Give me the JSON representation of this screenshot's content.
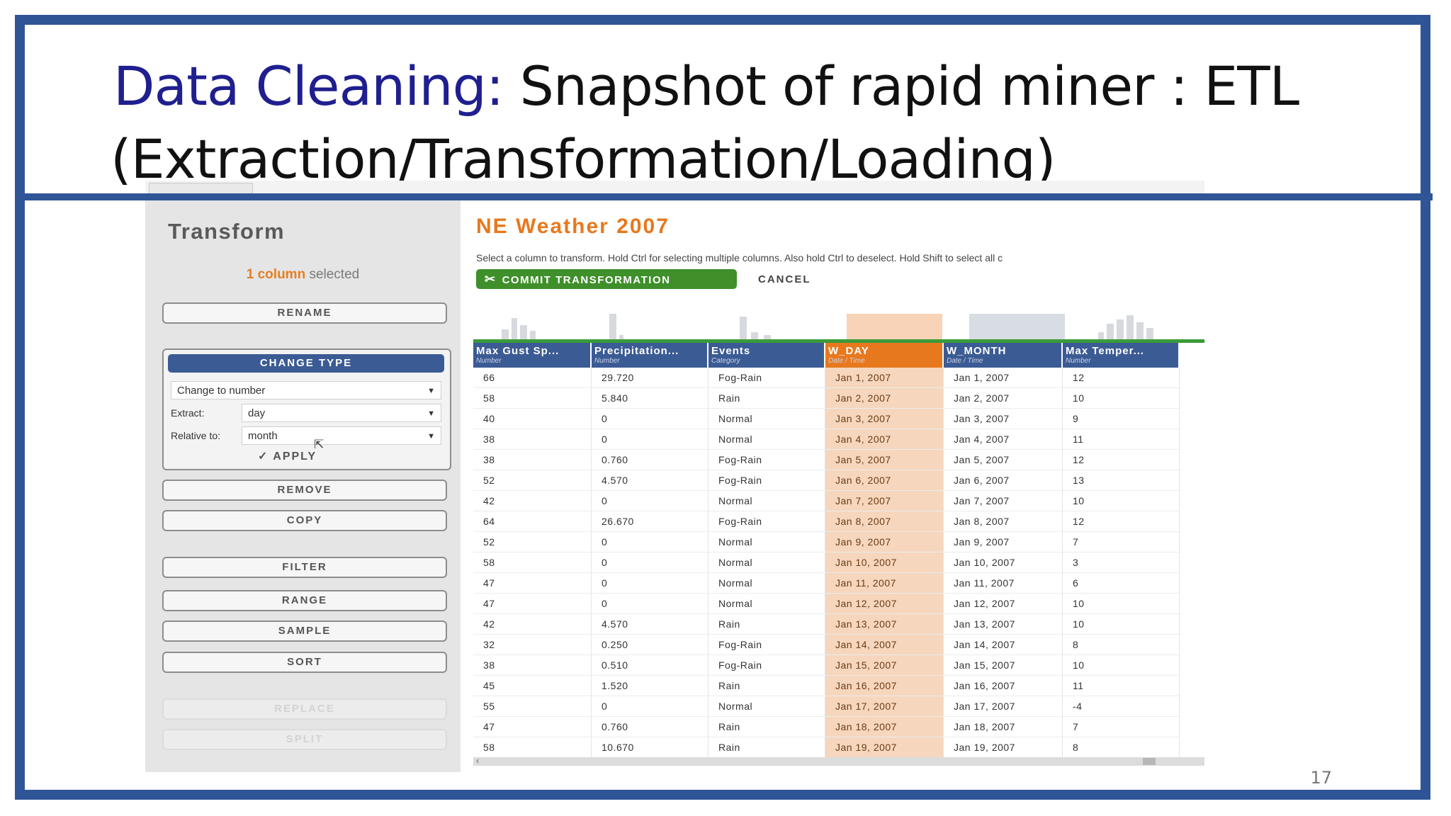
{
  "slide": {
    "title_accent": "Data Cleaning:",
    "title_line1": " Snapshot of rapid miner : ETL",
    "title_line2": "(Extraction/Transformation/Loading)",
    "page_number": "17"
  },
  "left_panel": {
    "title": "Transform",
    "selected_count": "1 column",
    "selected_suffix": " selected",
    "buttons": {
      "rename": "RENAME",
      "remove": "REMOVE",
      "copy": "COPY",
      "filter": "FILTER",
      "range": "RANGE",
      "sample": "SAMPLE",
      "sort": "SORT",
      "replace": "REPLACE",
      "split": "SPLIT"
    },
    "change_type": {
      "header": "CHANGE TYPE",
      "type_value": "Change to number",
      "extract_label": "Extract:",
      "extract_value": "day",
      "relative_label": "Relative to:",
      "relative_value": "month",
      "apply": "APPLY"
    }
  },
  "right_panel": {
    "dataset_title": "NE Weather 2007",
    "instructions": "Select a column to transform.  Hold Ctrl for selecting multiple columns.  Also hold Ctrl to deselect.  Hold Shift to select all c",
    "commit_label": "COMMIT TRANSFORMATION",
    "cancel_label": "CANCEL"
  },
  "table": {
    "columns": [
      {
        "name": "Max Gust Sp...",
        "type": "Number"
      },
      {
        "name": "Precipitation...",
        "type": "Number"
      },
      {
        "name": "Events",
        "type": "Category"
      },
      {
        "name": "W_DAY",
        "type": "Date / Time",
        "selected": true
      },
      {
        "name": "W_MONTH",
        "type": "Date / Time"
      },
      {
        "name": "Max Temper...",
        "type": "Number"
      }
    ],
    "rows": [
      [
        "66",
        "29.720",
        "Fog-Rain",
        "Jan 1, 2007",
        "Jan 1, 2007",
        "12"
      ],
      [
        "58",
        "5.840",
        "Rain",
        "Jan 2, 2007",
        "Jan 2, 2007",
        "10"
      ],
      [
        "40",
        "0",
        "Normal",
        "Jan 3, 2007",
        "Jan 3, 2007",
        "9"
      ],
      [
        "38",
        "0",
        "Normal",
        "Jan 4, 2007",
        "Jan 4, 2007",
        "11"
      ],
      [
        "38",
        "0.760",
        "Fog-Rain",
        "Jan 5, 2007",
        "Jan 5, 2007",
        "12"
      ],
      [
        "52",
        "4.570",
        "Fog-Rain",
        "Jan 6, 2007",
        "Jan 6, 2007",
        "13"
      ],
      [
        "42",
        "0",
        "Normal",
        "Jan 7, 2007",
        "Jan 7, 2007",
        "10"
      ],
      [
        "64",
        "26.670",
        "Fog-Rain",
        "Jan 8, 2007",
        "Jan 8, 2007",
        "12"
      ],
      [
        "52",
        "0",
        "Normal",
        "Jan 9, 2007",
        "Jan 9, 2007",
        "7"
      ],
      [
        "58",
        "0",
        "Normal",
        "Jan 10, 2007",
        "Jan 10, 2007",
        "3"
      ],
      [
        "47",
        "0",
        "Normal",
        "Jan 11, 2007",
        "Jan 11, 2007",
        "6"
      ],
      [
        "47",
        "0",
        "Normal",
        "Jan 12, 2007",
        "Jan 12, 2007",
        "10"
      ],
      [
        "42",
        "4.570",
        "Rain",
        "Jan 13, 2007",
        "Jan 13, 2007",
        "10"
      ],
      [
        "32",
        "0.250",
        "Fog-Rain",
        "Jan 14, 2007",
        "Jan 14, 2007",
        "8"
      ],
      [
        "38",
        "0.510",
        "Fog-Rain",
        "Jan 15, 2007",
        "Jan 15, 2007",
        "10"
      ],
      [
        "45",
        "1.520",
        "Rain",
        "Jan 16, 2007",
        "Jan 16, 2007",
        "11"
      ],
      [
        "55",
        "0",
        "Normal",
        "Jan 17, 2007",
        "Jan 17, 2007",
        "-4"
      ],
      [
        "47",
        "0.760",
        "Rain",
        "Jan 18, 2007",
        "Jan 18, 2007",
        "7"
      ],
      [
        "58",
        "10.670",
        "Rain",
        "Jan 19, 2007",
        "Jan 19, 2007",
        "8"
      ]
    ]
  },
  "colors": {
    "slide_frame": "#2f5597",
    "title_accent": "#1f1f8f",
    "dataset_title": "#e8781e",
    "column_header": "#3b5b94",
    "selected_column": "#e8781e",
    "commit_button": "#3f8f2b"
  },
  "icons": {
    "commit": "tools-icon",
    "apply": "check-icon",
    "dropdown": "chevron-down-icon",
    "cursor": "mouse-cursor-icon",
    "scroll_left": "chevron-left-icon"
  }
}
